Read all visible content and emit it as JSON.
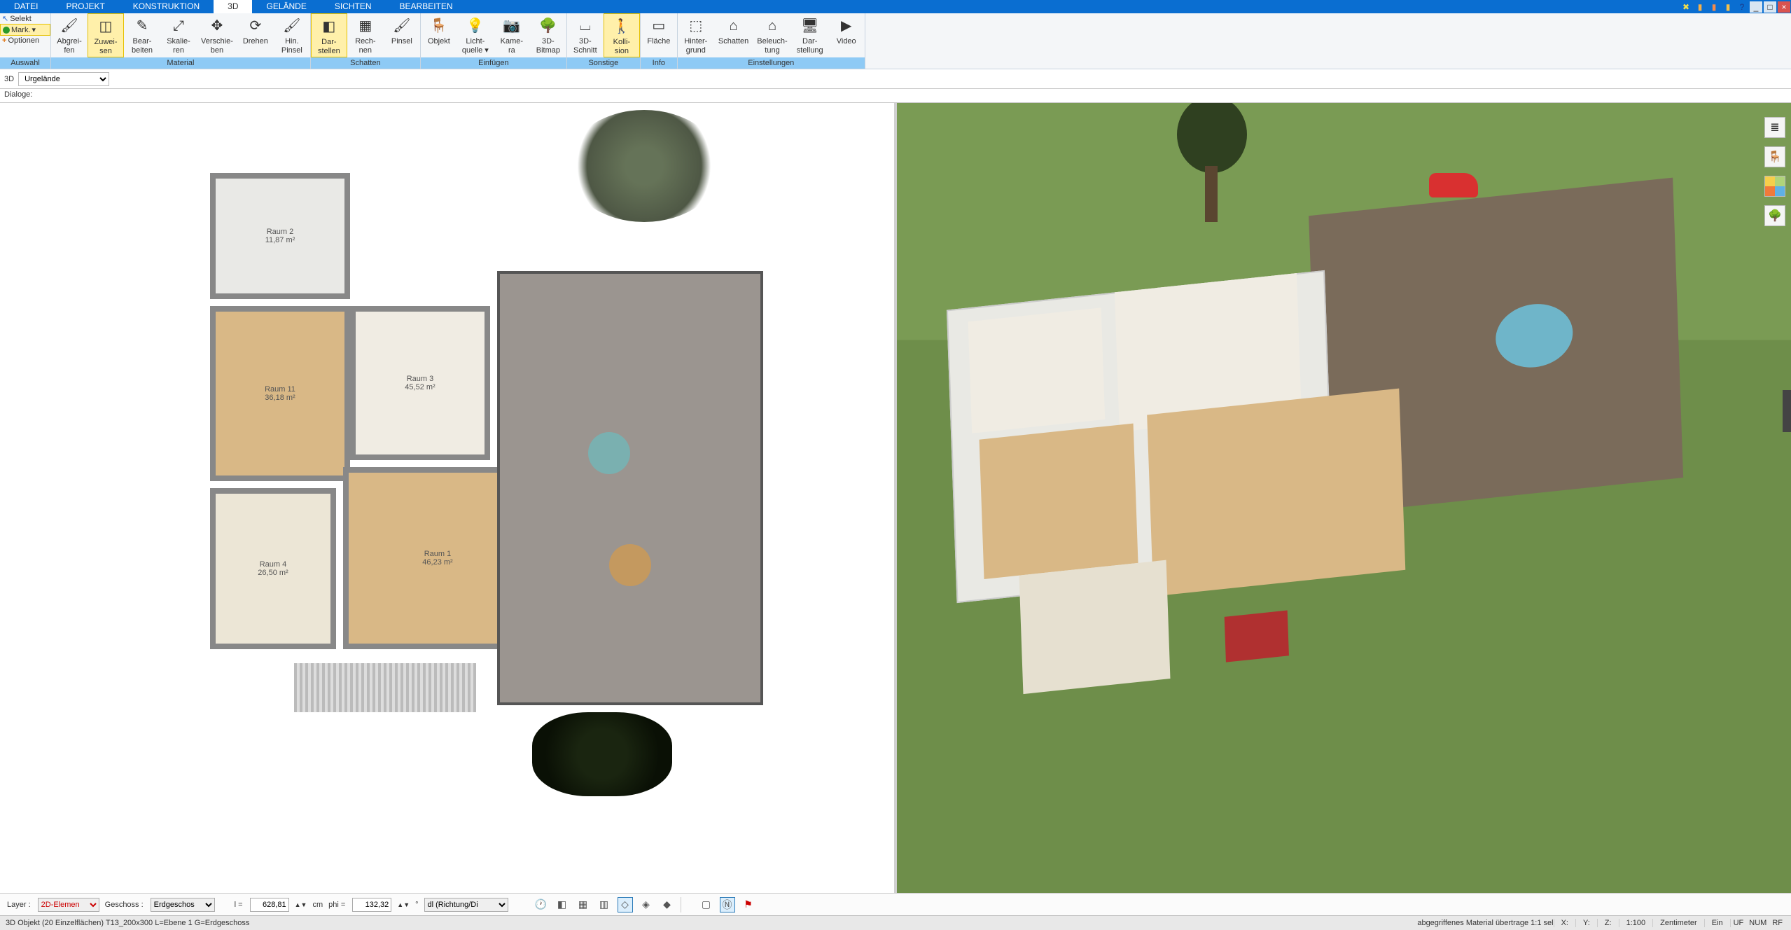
{
  "menu": {
    "items": [
      "DATEI",
      "PROJEKT",
      "KONSTRUKTION",
      "3D",
      "GELÄNDE",
      "SICHTEN",
      "BEARBEITEN"
    ],
    "active_index": 3
  },
  "window_controls": {
    "extras": [
      "tool1",
      "tool2",
      "tool3",
      "tool4",
      "help"
    ],
    "min": "_",
    "max": "□",
    "close": "×"
  },
  "ribbon_left": {
    "selekt": "Selekt",
    "mark": "Mark.",
    "optionen": "Optionen",
    "group_label": "Auswahl"
  },
  "ribbon": [
    {
      "label": "Material",
      "items": [
        {
          "name": "abgreifen",
          "l1": "Abgrei-",
          "l2": "fen",
          "icon": "🖌"
        },
        {
          "name": "zuweisen",
          "l1": "Zuwei-",
          "l2": "sen",
          "icon": "◫",
          "active": true
        },
        {
          "name": "bearbeiten",
          "l1": "Bear-",
          "l2": "beiten",
          "icon": "✎"
        },
        {
          "name": "skalieren",
          "l1": "Skalie-",
          "l2": "ren",
          "icon": "⤢"
        },
        {
          "name": "verschieben",
          "l1": "Verschie-",
          "l2": "ben",
          "icon": "✥"
        },
        {
          "name": "drehen",
          "l1": "Drehen",
          "l2": "",
          "icon": "⟳"
        },
        {
          "name": "hin-pinsel",
          "l1": "Hin.",
          "l2": "Pinsel",
          "icon": "🖌"
        }
      ]
    },
    {
      "label": "Schatten",
      "items": [
        {
          "name": "darstellen",
          "l1": "Dar-",
          "l2": "stellen",
          "icon": "◧",
          "active": true
        },
        {
          "name": "rechnen",
          "l1": "Rech-",
          "l2": "nen",
          "icon": "▦"
        },
        {
          "name": "pinsel",
          "l1": "Pinsel",
          "l2": "",
          "icon": "🖌"
        }
      ]
    },
    {
      "label": "Einfügen",
      "items": [
        {
          "name": "objekt",
          "l1": "Objekt",
          "l2": "",
          "icon": "🪑"
        },
        {
          "name": "lichtquelle",
          "l1": "Licht-",
          "l2": "quelle ▾",
          "icon": "💡"
        },
        {
          "name": "kamera",
          "l1": "Kame-",
          "l2": "ra",
          "icon": "📷"
        },
        {
          "name": "3d-bitmap",
          "l1": "3D-",
          "l2": "Bitmap",
          "icon": "🌳"
        }
      ]
    },
    {
      "label": "Sonstige",
      "items": [
        {
          "name": "3d-schnitt",
          "l1": "3D-",
          "l2": "Schnitt",
          "icon": "⌴"
        },
        {
          "name": "kollision",
          "l1": "Kolli-",
          "l2": "sion",
          "icon": "🚶",
          "active": true
        }
      ]
    },
    {
      "label": "Info",
      "items": [
        {
          "name": "flaeche",
          "l1": "Fläche",
          "l2": "",
          "icon": "▭"
        }
      ]
    },
    {
      "label": "Einstellungen",
      "items": [
        {
          "name": "hintergrund",
          "l1": "Hinter-",
          "l2": "grund",
          "icon": "⬚"
        },
        {
          "name": "schatten-einst",
          "l1": "Schatten",
          "l2": "",
          "icon": "⌂"
        },
        {
          "name": "beleuchtung",
          "l1": "Beleuch-",
          "l2": "tung",
          "icon": "⌂"
        },
        {
          "name": "darstellung",
          "l1": "Dar-",
          "l2": "stellung",
          "icon": "🖥"
        },
        {
          "name": "video",
          "l1": "Video",
          "l2": "",
          "icon": "▶"
        }
      ]
    }
  ],
  "sub_toolbar": {
    "mode_label": "3D",
    "dropdown_value": "Urgelände"
  },
  "dialoge_label": "Dialoge:",
  "plan_rooms": {
    "r2": {
      "name": "Raum 2",
      "area": "11,87 m²"
    },
    "r11": {
      "name": "Raum 11",
      "area": "36,18 m²"
    },
    "r3": {
      "name": "Raum 3",
      "area": "45,52 m²"
    },
    "r4": {
      "name": "Raum 4",
      "area": "26,50 m²"
    },
    "r1": {
      "name": "Raum 1",
      "area": "46,23 m²"
    }
  },
  "bottom": {
    "layer_label": "Layer :",
    "layer_value": "2D-Elemen",
    "geschoss_label": "Geschoss :",
    "geschoss_value": "Erdgeschos",
    "l_label": "l =",
    "l_value": "628,81",
    "cm": "cm",
    "phi_label": "phi =",
    "phi_value": "132,32",
    "deg": "°",
    "dl_value": "dl (Richtung/Di"
  },
  "status": {
    "left": "3D Objekt (20 Einzelflächen) T13_200x300 L=Ebene 1 G=Erdgeschoss",
    "center": "abgegriffenes Material übertrage 1:1 sel",
    "x": "X:",
    "y": "Y:",
    "z": "Z:",
    "scale": "1:100",
    "unit": "Zentimeter",
    "ein": "Ein",
    "uf": "UF",
    "num": "NUM",
    "rf": "RF"
  },
  "palette": {
    "layers": "≣",
    "chair": "🪑",
    "tree": "🌳"
  }
}
